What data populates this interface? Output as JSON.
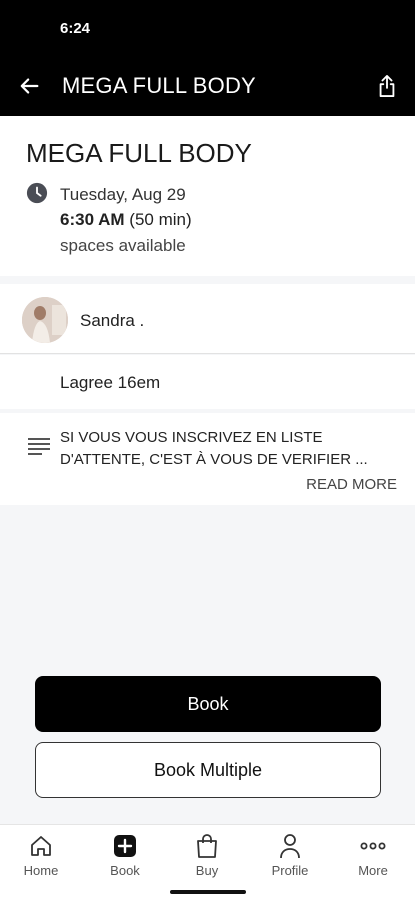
{
  "status_bar": {
    "time": "6:24"
  },
  "app_bar": {
    "title": "MEGA FULL BODY"
  },
  "class": {
    "title": "MEGA FULL BODY",
    "date": "Tuesday, Aug 29",
    "time": "6:30 AM",
    "duration": "(50 min)",
    "availability": "spaces available"
  },
  "instructor": {
    "name": "Sandra ."
  },
  "location": {
    "name": "Lagree 16em"
  },
  "description": {
    "text": "SI VOUS VOUS INSCRIVEZ EN LISTE D'ATTENTE, C'EST À VOUS DE VERIFIER ...",
    "read_more": "READ MORE"
  },
  "actions": {
    "book": "Book",
    "book_multiple": "Book Multiple"
  },
  "tabs": [
    {
      "label": "Home",
      "icon": "home-icon"
    },
    {
      "label": "Book",
      "icon": "plus-square-icon"
    },
    {
      "label": "Buy",
      "icon": "shopping-bag-icon"
    },
    {
      "label": "Profile",
      "icon": "person-icon"
    },
    {
      "label": "More",
      "icon": "more-dots-icon"
    }
  ],
  "colors": {
    "header": "#000000",
    "primary_button": "#000000",
    "background": "#f5f6f8"
  }
}
